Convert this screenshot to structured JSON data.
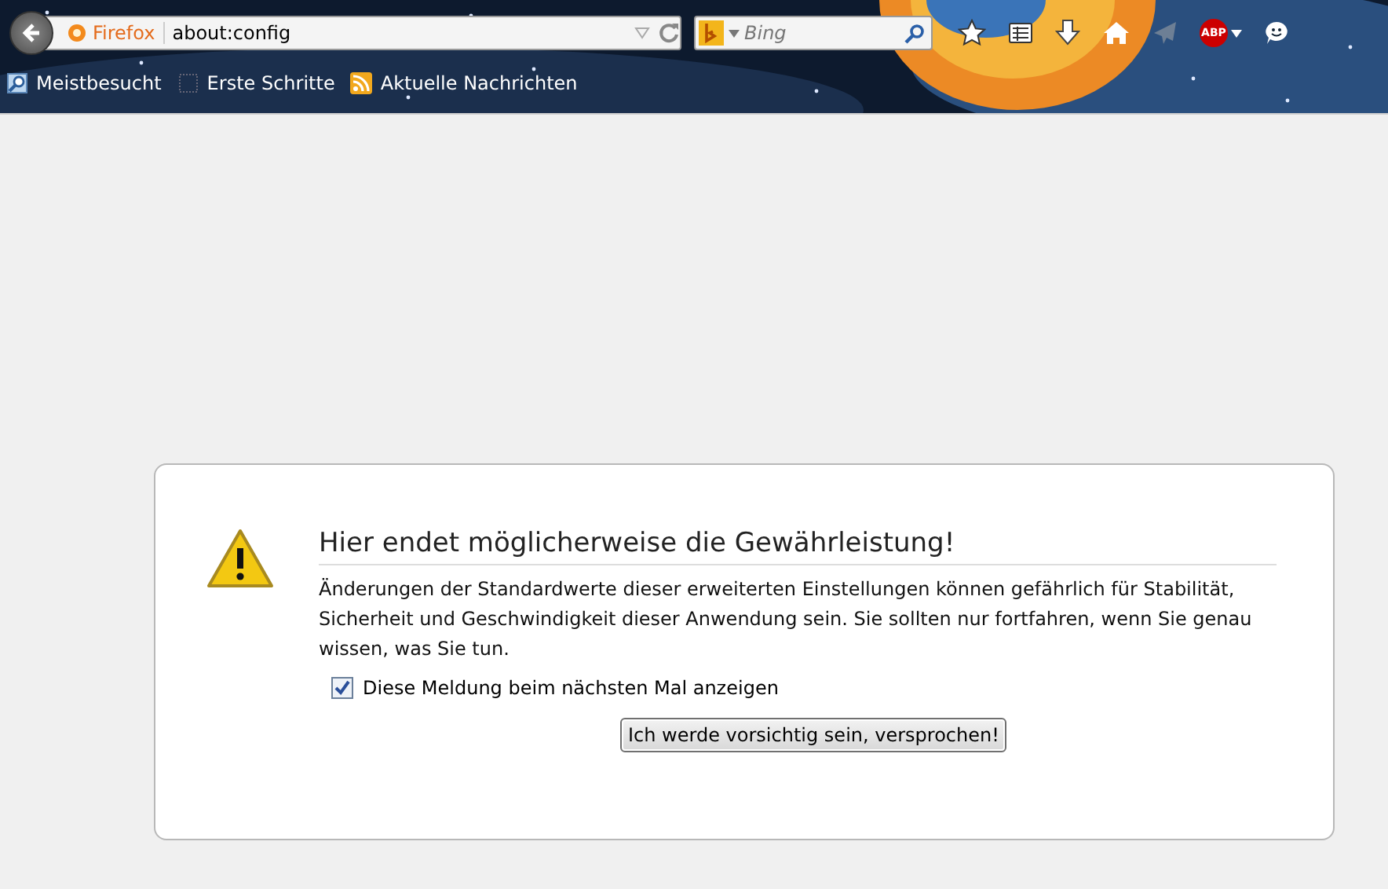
{
  "toolbar": {
    "identity_label": "Firefox",
    "url": "about:config",
    "search_placeholder": "Bing",
    "abp_label": "ABP"
  },
  "bookmarks": [
    {
      "label": "Meistbesucht",
      "kind": "search"
    },
    {
      "label": "Erste Schritte",
      "kind": "page"
    },
    {
      "label": "Aktuelle Nachrichten",
      "kind": "feed"
    }
  ],
  "dialog": {
    "title": "Hier endet möglicherweise die Gewährleistung!",
    "text": "Änderungen der Standardwerte dieser erweiterten Einstellungen können gefährlich für Stabilität, Sicherheit und Geschwindigkeit dieser Anwendung sein. Sie sollten nur fortfahren, wenn Sie genau wissen, was Sie tun.",
    "checkbox": {
      "label": "Diese Meldung beim nächsten Mal anzeigen",
      "checked": true
    },
    "button": "Ich werde vorsichtig sein, versprochen!"
  }
}
